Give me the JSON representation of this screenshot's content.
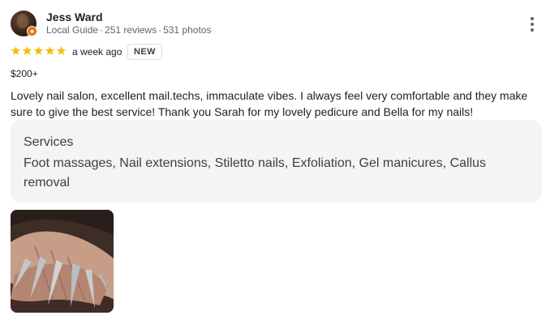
{
  "reviewer": {
    "name": "Jess Ward",
    "guide_label": "Local Guide",
    "reviews": "251 reviews",
    "photos": "531 photos",
    "separator": "·"
  },
  "rating": {
    "stars": 5,
    "star_color": "#fbbc04",
    "time_ago": "a week ago",
    "badge": "NEW"
  },
  "price": "$200+",
  "review_text": "Lovely nail salon, excellent mail.techs, immaculate vibes. I always feel very comfortable and they make sure to give the best service! Thank you Sarah for my lovely pedicure and Bella for my nails!",
  "services": {
    "title": "Services",
    "list": "Foot massages, Nail extensions, Stiletto nails, Exfoliation, Gel manicures, Callus removal"
  },
  "icons": {
    "more": "more-vert-icon",
    "badge": "local-guide-star-icon",
    "star": "star-icon"
  },
  "colors": {
    "accent_orange": "#e8710a",
    "text_primary": "#202124",
    "text_secondary": "#5f6368",
    "services_bg": "#f4f4f5"
  }
}
